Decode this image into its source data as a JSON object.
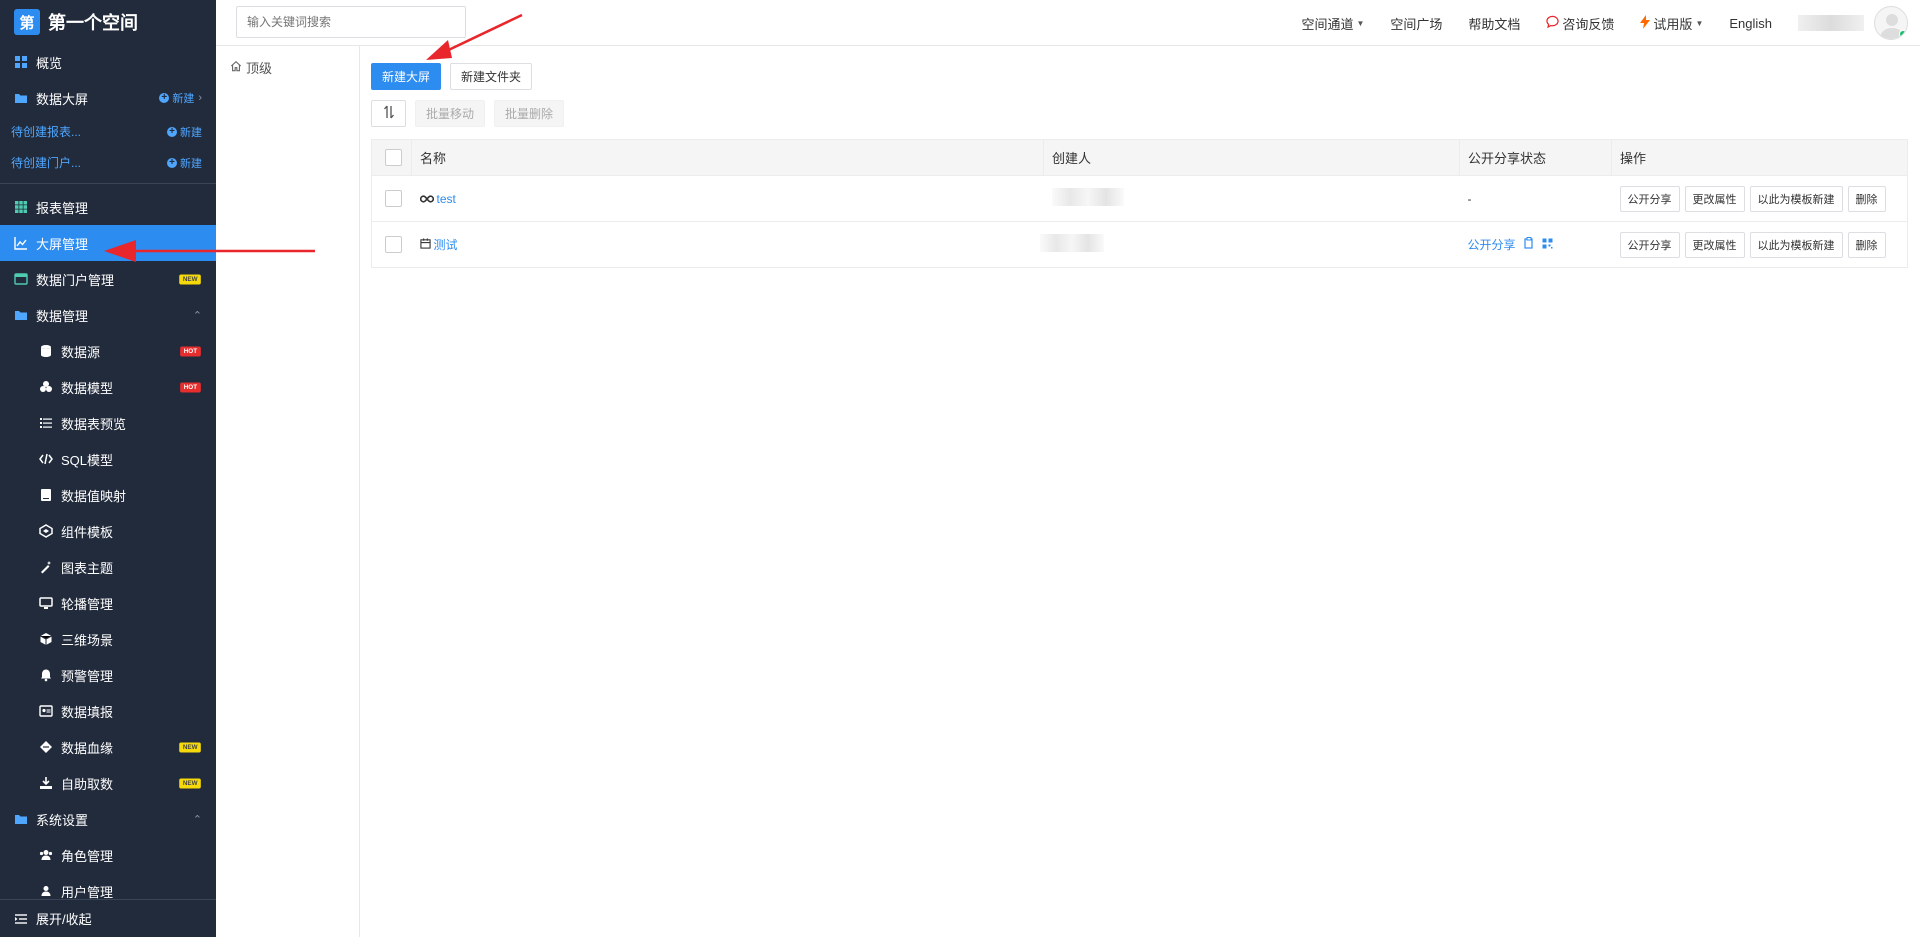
{
  "sidebar": {
    "brand_logo": "第",
    "brand_title": "第一个空间",
    "overview": "概览",
    "bigscreen_folder": "数据大屏",
    "new_label": "新建",
    "pending_report": "待创建报表...",
    "pending_portal": "待创建门户...",
    "report_mgmt": "报表管理",
    "screen_mgmt": "大屏管理",
    "portal_mgmt": "数据门户管理",
    "data_mgmt": "数据管理",
    "data_items": [
      {
        "label": "数据源",
        "badge": "HOT"
      },
      {
        "label": "数据模型",
        "badge": "HOT"
      },
      {
        "label": "数据表预览",
        "badge": ""
      },
      {
        "label": "SQL模型",
        "badge": ""
      },
      {
        "label": "数据值映射",
        "badge": ""
      },
      {
        "label": "组件模板",
        "badge": ""
      },
      {
        "label": "图表主题",
        "badge": ""
      },
      {
        "label": "轮播管理",
        "badge": ""
      },
      {
        "label": "三维场景",
        "badge": ""
      },
      {
        "label": "预警管理",
        "badge": ""
      },
      {
        "label": "数据填报",
        "badge": ""
      },
      {
        "label": "数据血缘",
        "badge": "NEW"
      },
      {
        "label": "自助取数",
        "badge": "NEW"
      }
    ],
    "system_settings": "系统设置",
    "role_mgmt": "角色管理",
    "user_mgmt": "用户管理",
    "new_badge": "NEW",
    "footer": "展开/收起"
  },
  "topbar": {
    "search_placeholder": "输入关键词搜索",
    "links": {
      "channel": "空间通道",
      "plaza": "空间广场",
      "docs": "帮助文档",
      "feedback": "咨询反馈",
      "trial": "试用版",
      "lang": "English"
    }
  },
  "folder": {
    "root": "顶级"
  },
  "toolbar": {
    "new_screen": "新建大屏",
    "new_folder": "新建文件夹",
    "batch_move": "批量移动",
    "batch_delete": "批量删除"
  },
  "table": {
    "headers": {
      "name": "名称",
      "creator": "创建人",
      "share_status": "公开分享状态",
      "actions": "操作"
    },
    "rows": [
      {
        "name": "test",
        "share_status": "-"
      },
      {
        "name": "测试",
        "share_status": "公开分享"
      }
    ],
    "actions": {
      "share": "公开分享",
      "props": "更改属性",
      "template": "以此为模板新建",
      "delete": "删除"
    }
  },
  "colors": {
    "sidebar_bg": "#222b3c",
    "accent": "#2d8cf0",
    "hot": "#e62e2e",
    "new": "#f5d90a",
    "annotation": "#e8262b"
  }
}
